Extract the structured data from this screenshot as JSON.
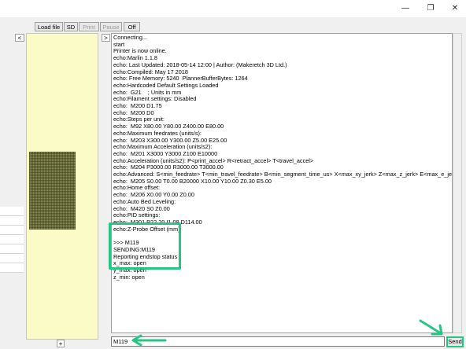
{
  "window": {
    "minimize_glyph": "—",
    "maximize_glyph": "❐",
    "close_glyph": "✕"
  },
  "toolbar": {
    "load_file": "Load file",
    "sd": "SD",
    "print": "Print",
    "pause": "Pause",
    "off": "Off"
  },
  "left_panel": {
    "collapse_glyph": "<",
    "add_glyph": "+"
  },
  "console_panel": {
    "expand_glyph": ">",
    "lines": [
      "Connecting...",
      "start",
      "Printer is now online.",
      "echo:Marlin 1.1.8",
      "echo: Last Updated: 2018-05-14 12:00 | Author: (Makeretch 3D Ltd.)",
      "echo:Compiled: May 17 2018",
      "echo: Free Memory: 5240  PlannerBufferBytes: 1264",
      "echo:Hardcoded Default Settings Loaded",
      "echo:  G21    ; Units in mm",
      "echo:Filament settings: Disabled",
      "echo:  M200 D1.75",
      "echo:  M200 D0",
      "echo:Steps per unit:",
      "echo:  M92 X80.00 Y80.00 Z400.00 E80.00",
      "echo:Maximum feedrates (units/s):",
      "echo:  M203 X300.00 Y300.00 Z5.00 E25.00",
      "echo:Maximum Acceleration (units/s2):",
      "echo:  M201 X3000 Y3000 Z100 E10000",
      "echo:Acceleration (units/s2): P<print_accel> R<retract_accel> T<travel_accel>",
      "echo:  M204 P3000.00 R3000.00 T3000.00",
      "echo:Advanced: S<min_feedrate> T<min_travel_feedrate> B<min_segment_time_us> X<max_xy_jerk> Z<max_z_jerk> E<max_e_jerk>",
      "echo:  M205 S0.00 T0.00 B20000 X10.00 Y10.00 Z0.30 E5.00",
      "echo:Home offset:",
      "echo:  M206 X0.00 Y0.00 Z0.00",
      "echo:Auto Bed Leveling:",
      "echo:  M420 S0 Z0.00",
      "echo:PID settings:",
      "echo:  M301 P22.20 I1.08 D114.00",
      "echo:Z-Probe Offset (mm):",
      "",
      ">>> M119",
      "SENDING:M119",
      "Reporting endstop status",
      "x_max: open",
      "y_max: open",
      "z_min: open"
    ]
  },
  "command": {
    "value": "M119",
    "send_label": "Send"
  },
  "colors": {
    "highlight": "#27c584",
    "preview_bg": "#fbfbc7"
  }
}
